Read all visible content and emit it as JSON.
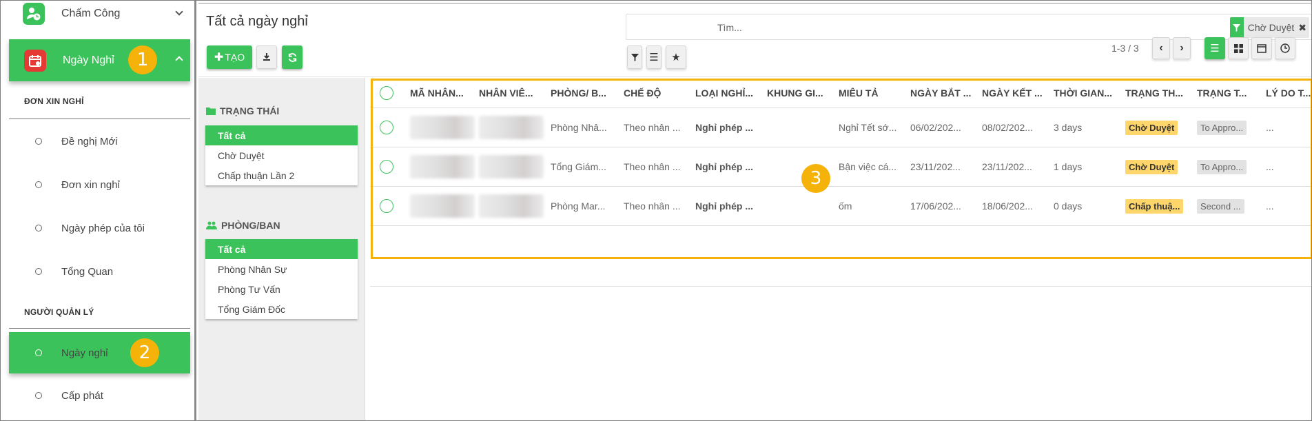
{
  "sidebar": {
    "top_item": {
      "label": "Chấm Công",
      "icon": "clock-user-icon"
    },
    "active_app": {
      "label": "Ngày Nghỉ",
      "icon": "calendar-icon",
      "badge": "1"
    },
    "section1_title": "ĐƠN XIN NGHỈ",
    "section1_items": [
      {
        "label": "Đề nghị Mới"
      },
      {
        "label": "Đơn xin nghỉ"
      },
      {
        "label": "Ngày phép của tôi"
      },
      {
        "label": "Tổng Quan"
      }
    ],
    "section2_title": "NGƯỜI QUẢN LÝ",
    "section2_items": [
      {
        "label": "Ngày nghỉ",
        "badge": "2"
      },
      {
        "label": "Cấp phát"
      }
    ]
  },
  "header": {
    "title": "Tất cả ngày nghỉ",
    "create_label": "TẠO",
    "search_placeholder": "Tìm...",
    "filter_chip": "Chờ Duyệt",
    "pager": "1-3 / 3"
  },
  "filter_panel": {
    "status_title": "TRẠNG THÁI",
    "status_items": [
      "Tất cả",
      "Chờ Duyệt",
      "Chấp thuận Lần 2"
    ],
    "dept_title": "PHÒNG/BAN",
    "dept_items": [
      "Tất cả",
      "Phòng Nhân Sự",
      "Phòng Tư Vấn",
      "Tổng Giám Đốc"
    ]
  },
  "table": {
    "columns": [
      "MÃ NHÂN...",
      "NHÂN VIÊ...",
      "PHÒNG/ B...",
      "CHẾ ĐỘ",
      "LOẠI NGHỈ...",
      "KHUNG GI...",
      "MIÊU TẢ",
      "NGÀY BẮT ...",
      "NGÀY KẾT ...",
      "THỜI GIAN...",
      "TRẠNG TH...",
      "TRẠNG T...",
      "LÝ DO T..."
    ],
    "rows": [
      {
        "dept": "Phòng Nhâ...",
        "mode": "Theo nhân ...",
        "type": "Nghỉ phép ...",
        "frame": "",
        "desc": "Nghỉ Tết sớ...",
        "start": "06/02/202...",
        "end": "08/02/202...",
        "duration": "3 days",
        "status": "Chờ Duyệt",
        "status2": "To Appro...",
        "reason": "..."
      },
      {
        "dept": "Tổng Giám...",
        "mode": "Theo nhân ...",
        "type": "Nghỉ phép ...",
        "frame": "",
        "desc": "Bận việc cá...",
        "start": "23/11/202...",
        "end": "23/11/202...",
        "duration": "1 days",
        "status": "Chờ Duyệt",
        "status2": "To Appro...",
        "reason": "..."
      },
      {
        "dept": "Phòng Mar...",
        "mode": "Theo nhân ...",
        "type": "Nghỉ phép ...",
        "frame": "",
        "desc": "ốm",
        "start": "17/06/202...",
        "end": "18/06/202...",
        "duration": "0 days",
        "status": "Chấp thuậ...",
        "status2": "Second ...",
        "reason": "..."
      }
    ]
  },
  "annotation": {
    "badge3": "3"
  },
  "colors": {
    "green": "#3cc25a",
    "badge": "#f5b30a",
    "tag_yellow": "#ffd66b",
    "calendar_red": "#e53935"
  }
}
